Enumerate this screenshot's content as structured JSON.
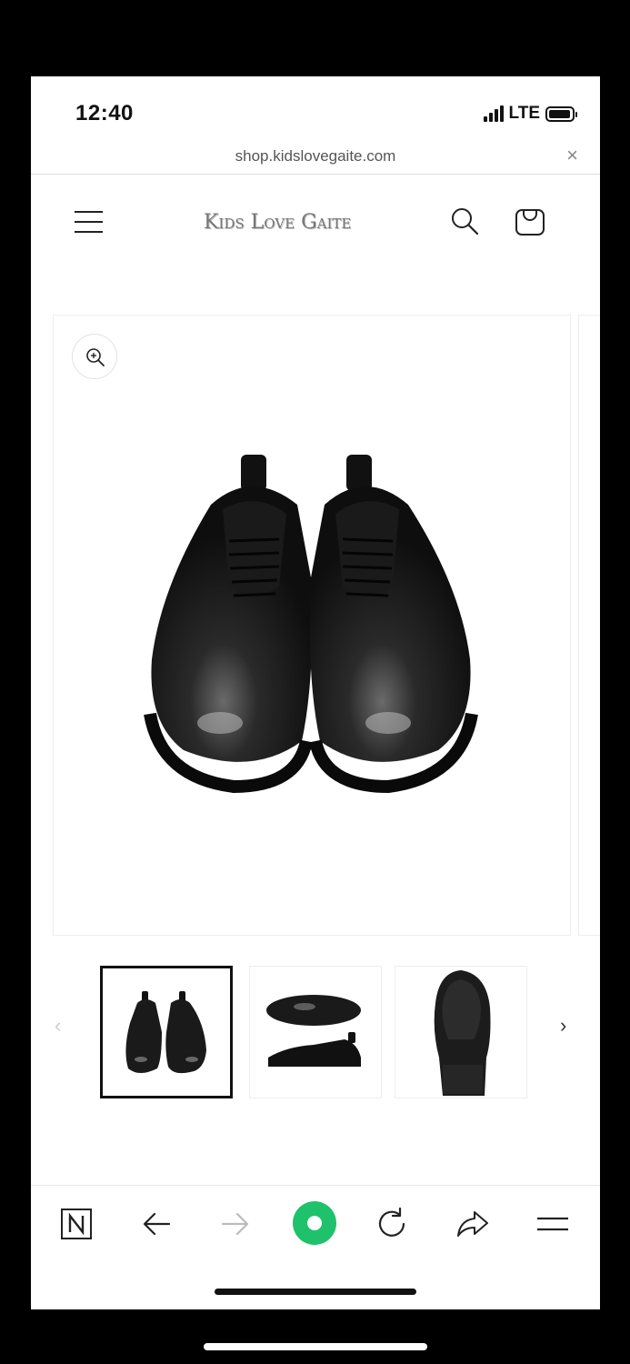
{
  "status": {
    "time": "12:40",
    "network": "LTE",
    "icons": [
      "signal-icon",
      "battery-icon"
    ]
  },
  "browser": {
    "url": "shop.kidslovegaite.com",
    "close_symbol": "×"
  },
  "header": {
    "logo_text": "Kids Love Gaite",
    "icons": [
      "menu-icon",
      "search-icon",
      "cart-icon"
    ]
  },
  "gallery": {
    "zoom_icon": "zoom-in-icon",
    "main_image": "black leather derby shoes, front view",
    "thumbnails": [
      {
        "label": "front view",
        "active": true
      },
      {
        "label": "side view",
        "active": false
      },
      {
        "label": "sole view",
        "active": false
      }
    ],
    "prev_symbol": "‹",
    "next_symbol": "›"
  },
  "toolbar": {
    "icons": [
      "notion-icon",
      "back-arrow-icon",
      "forward-arrow-icon",
      "home-circle-icon",
      "reload-icon",
      "share-icon",
      "menu-lines-icon"
    ]
  },
  "colors": {
    "accent": "#1fc26b",
    "text": "#111111",
    "muted": "#888888"
  }
}
